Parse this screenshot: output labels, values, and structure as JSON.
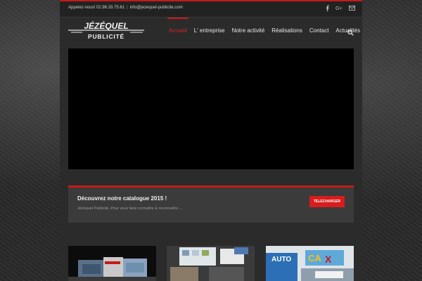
{
  "topbar": {
    "phone": "Appelez-nous! 02.96.33.75.61",
    "separator": "|",
    "email": "info@jezequel-publicite.com",
    "social_icons": [
      "facebook-icon",
      "google-plus-icon",
      "mail-icon"
    ]
  },
  "logo": {
    "line1": "JÉZÉQUEL",
    "line2": "PUBLICITÉ"
  },
  "nav": {
    "items": [
      {
        "label": "Accueil",
        "active": true
      },
      {
        "label": "L' entreprise",
        "active": false
      },
      {
        "label": "Notre activité",
        "active": false
      },
      {
        "label": "Réalisations",
        "active": false
      },
      {
        "label": "Contact",
        "active": false
      },
      {
        "label": "Actualités",
        "active": false
      }
    ],
    "search_icon": "search-icon"
  },
  "promo": {
    "title": "Découvrez notre catalogue 2015 !",
    "subtitle": "Jézéquel Publicité, Pour vous faire connaître & reconnaître ...",
    "button_label": "TELECHARGER"
  },
  "colors": {
    "accent": "#c41a1a",
    "button": "#d91c1c",
    "background": "#2b2b2b",
    "video": "#000000"
  }
}
